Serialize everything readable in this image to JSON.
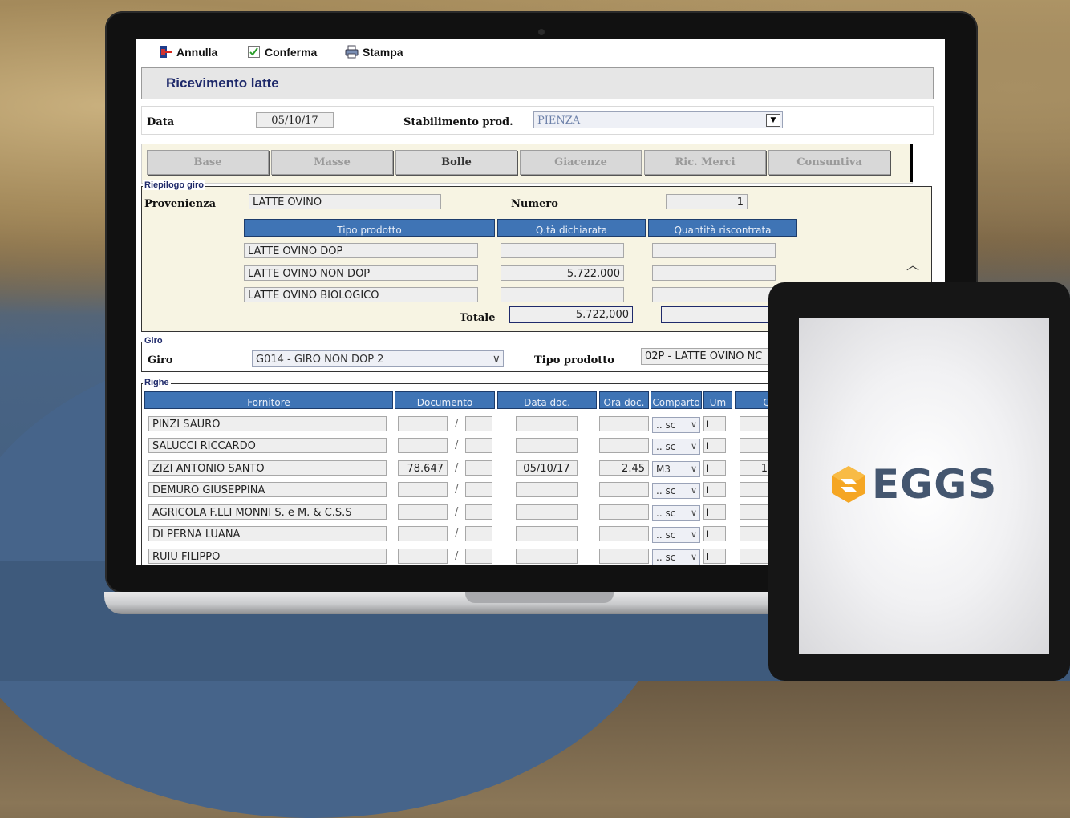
{
  "toolbar": {
    "annulla": "Annulla",
    "conferma": "Conferma",
    "stampa": "Stampa"
  },
  "page_title": "Ricevimento latte",
  "header": {
    "data_label": "Data",
    "data_value": "05/10/17",
    "stabilimento_label": "Stabilimento prod.",
    "stabilimento_value": "PIENZA"
  },
  "tabs": [
    {
      "label": "Base"
    },
    {
      "label": "Masse"
    },
    {
      "label": "Bolle"
    },
    {
      "label": "Giacenze"
    },
    {
      "label": "Ric. Merci"
    },
    {
      "label": "Consuntiva"
    }
  ],
  "active_tab": "Bolle",
  "riepilogo": {
    "legend": "Riepilogo giro",
    "provenienza_label": "Provenienza",
    "provenienza_value": "LATTE OVINO",
    "numero_label": "Numero",
    "numero_value": "1",
    "columns": [
      "Tipo prodotto",
      "Q.tà dichiarata",
      "Quantità riscontrata"
    ],
    "rows": [
      {
        "tipo": "LATTE OVINO DOP",
        "dichiarata": "",
        "riscontrata": ""
      },
      {
        "tipo": "LATTE OVINO NON DOP",
        "dichiarata": "5.722,000",
        "riscontrata": ""
      },
      {
        "tipo": "LATTE OVINO BIOLOGICO",
        "dichiarata": "",
        "riscontrata": ""
      }
    ],
    "totale_label": "Totale",
    "totale_value": "5.722,000",
    "totale_riscontrata": ""
  },
  "giro": {
    "legend": "Giro",
    "giro_label": "Giro",
    "giro_value": "G014 - GIRO NON DOP 2",
    "tipo_label": "Tipo prodotto",
    "tipo_value": "02P - LATTE OVINO NC"
  },
  "righe": {
    "legend": "Righe",
    "columns": [
      "Fornitore",
      "Documento",
      "Data doc.",
      "Ora doc.",
      "Comparto",
      "Um",
      "Q"
    ],
    "rows": [
      {
        "fornitore": "PINZI SAURO",
        "documento": "",
        "data": "",
        "ora": "",
        "comparto": ".. sc",
        "um": "l",
        "q": ""
      },
      {
        "fornitore": "SALUCCI RICCARDO",
        "documento": "",
        "data": "",
        "ora": "",
        "comparto": ".. sc",
        "um": "l",
        "q": ""
      },
      {
        "fornitore": "ZIZI ANTONIO SANTO",
        "documento": "78.647",
        "data": "05/10/17",
        "ora": "2.45",
        "comparto": "M3",
        "um": "l",
        "q": "1"
      },
      {
        "fornitore": "DEMURO  GIUSEPPINA",
        "documento": "",
        "data": "",
        "ora": "",
        "comparto": ".. sc",
        "um": "l",
        "q": ""
      },
      {
        "fornitore": "AGRICOLA F.LLI MONNI S. e M. & C.S.S",
        "documento": "",
        "data": "",
        "ora": "",
        "comparto": ".. sc",
        "um": "l",
        "q": ""
      },
      {
        "fornitore": "DI PERNA LUANA",
        "documento": "",
        "data": "",
        "ora": "",
        "comparto": ".. sc",
        "um": "l",
        "q": ""
      },
      {
        "fornitore": "RUIU FILIPPO",
        "documento": "",
        "data": "",
        "ora": "",
        "comparto": ".. sc",
        "um": "l",
        "q": ""
      }
    ]
  },
  "logo_text": "EGGS",
  "colors": {
    "header_blue": "#3f74b5",
    "title_navy": "#1f2a6b",
    "panel_cream": "#f7f4e3",
    "logo_orange": "#f5a623",
    "logo_slate": "#44566f"
  }
}
